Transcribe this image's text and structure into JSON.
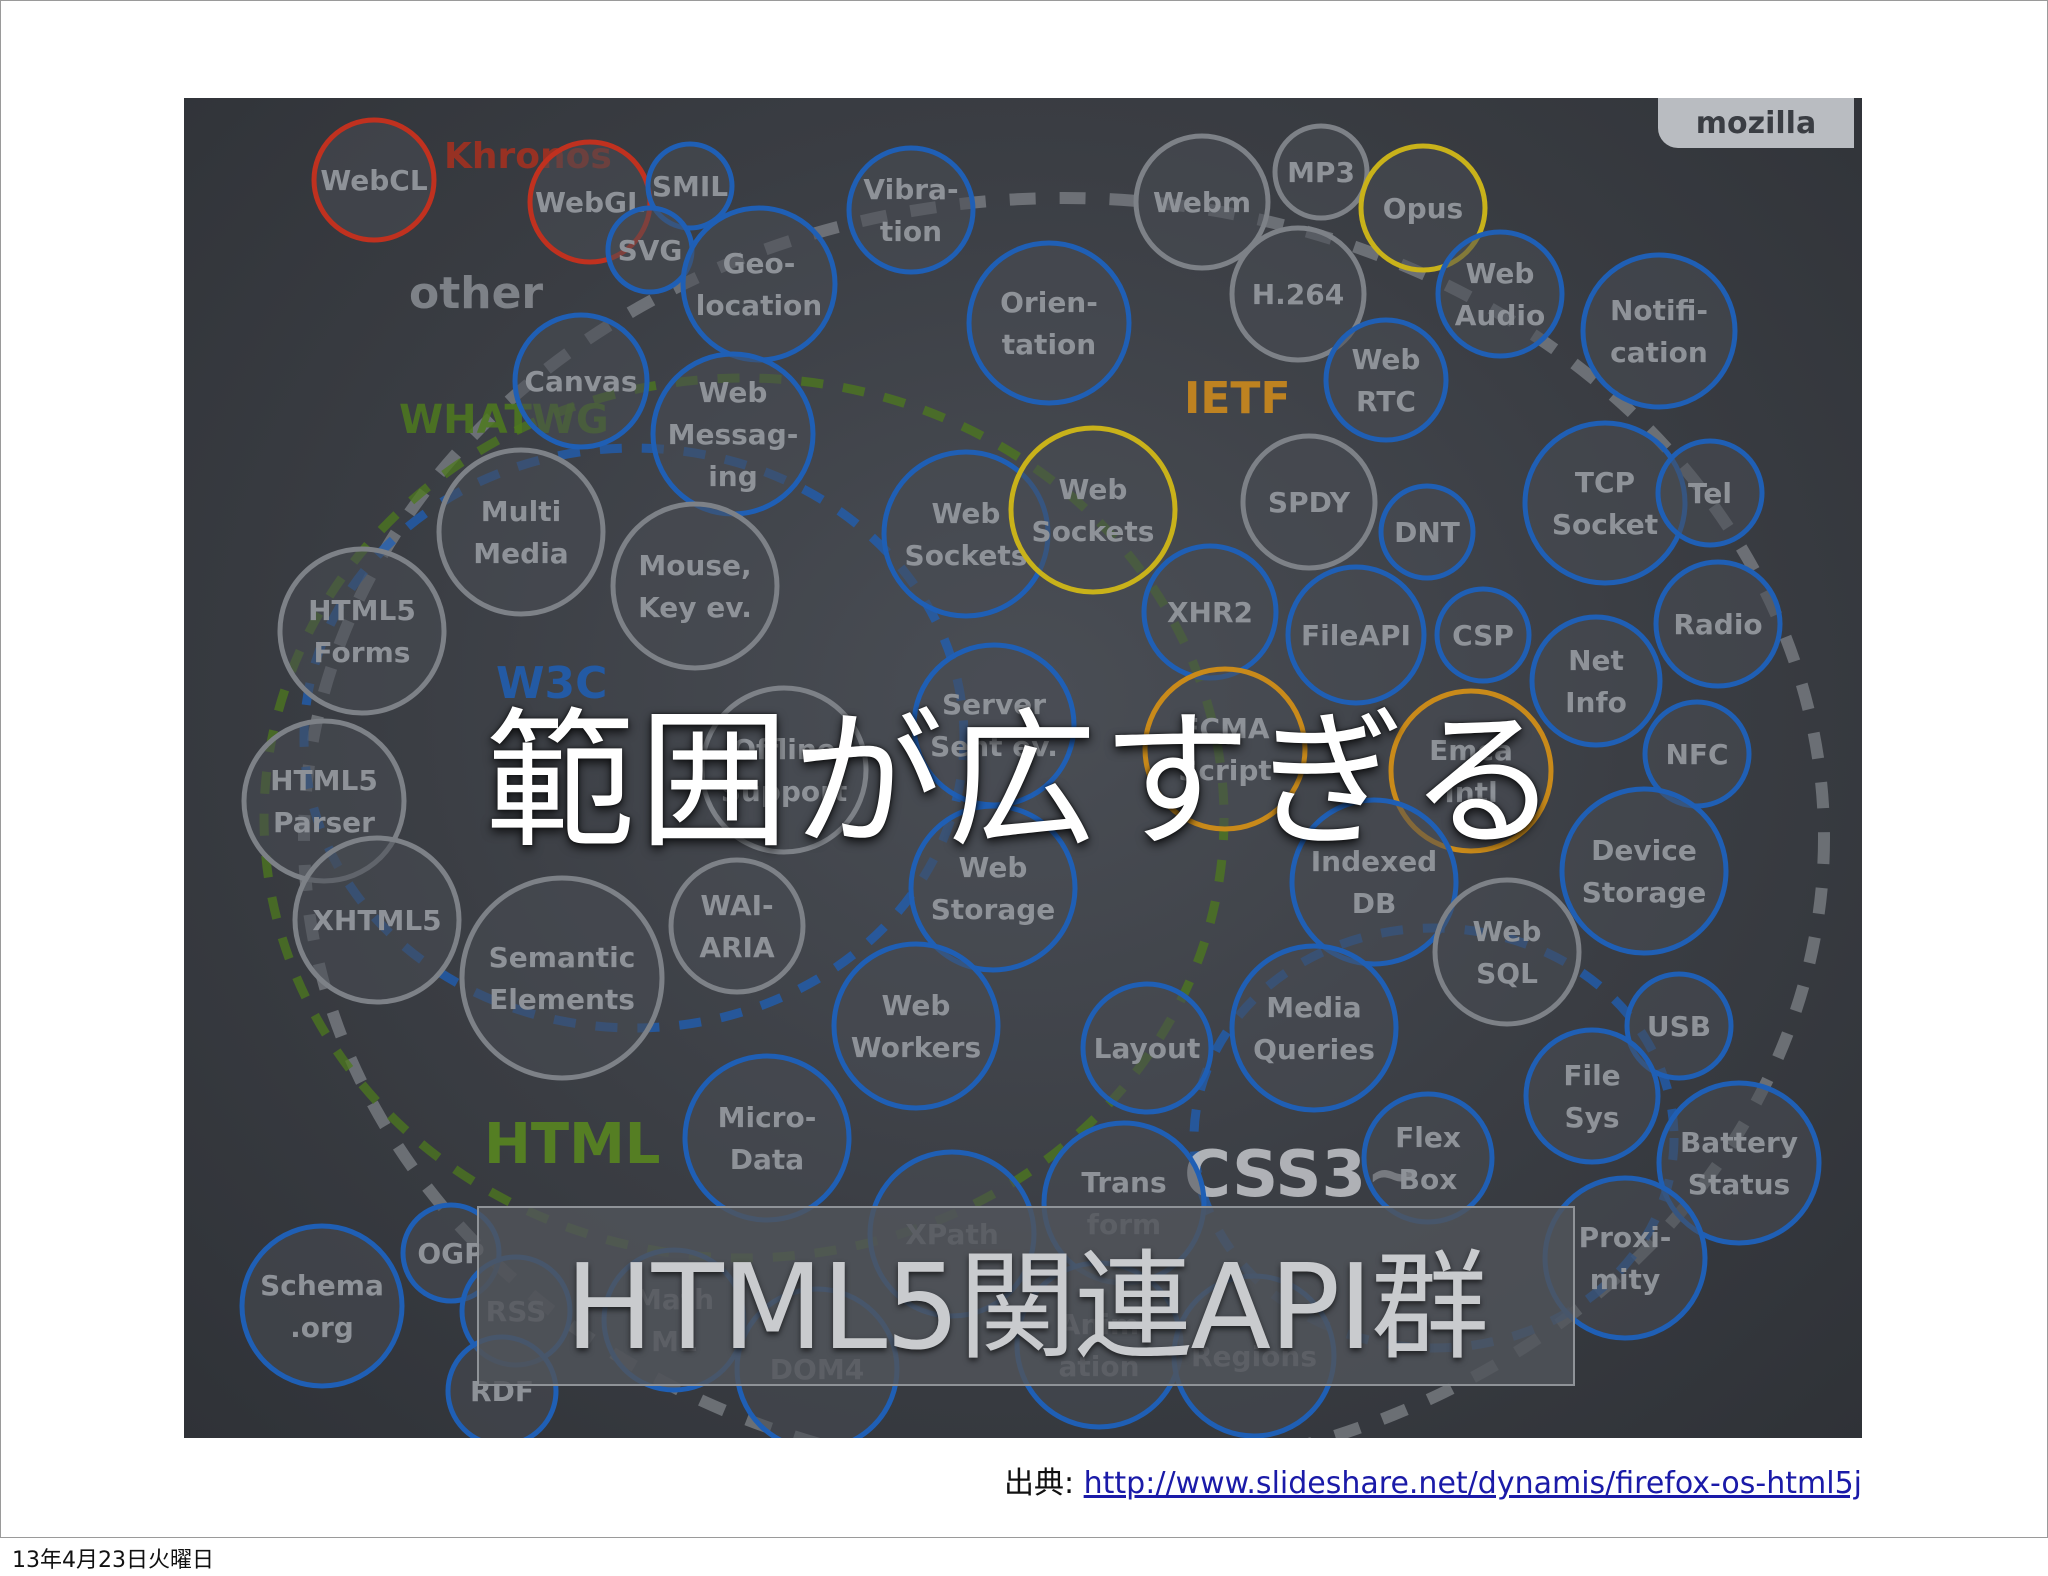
{
  "slide": {
    "headline": "範囲が広すぎる",
    "caption": "HTML5関連API群",
    "source_prefix": "出典: ",
    "source_url": "http://www.slideshare.net/dynamis/firefox-os-html5j",
    "date_stamp": "13年4月23日火曜日"
  },
  "diagram": {
    "brand": "mozilla",
    "colors": {
      "blue": "#1f5fb5",
      "gray": "#7d8187",
      "red": "#c0311f",
      "yellow": "#c9b21a",
      "orange": "#c98a1a",
      "green": "#4e7a1e"
    },
    "groups": [
      {
        "name": "khronos",
        "label": "Khronos",
        "color": "red"
      },
      {
        "name": "other",
        "label": "other",
        "color": "gray"
      },
      {
        "name": "whatwg",
        "label": "WHATWG",
        "color": "green"
      },
      {
        "name": "w3c",
        "label": "W3C",
        "color": "blue"
      },
      {
        "name": "ietf",
        "label": "IETF",
        "color": "orange"
      },
      {
        "name": "html",
        "label": "HTML",
        "color": "green"
      },
      {
        "name": "css3",
        "label": "CSS3~",
        "color": "gray"
      }
    ],
    "bubbles": [
      {
        "lines": [
          "WebCL"
        ],
        "color": "red"
      },
      {
        "lines": [
          "WebGL"
        ],
        "color": "red"
      },
      {
        "lines": [
          "SMIL"
        ],
        "color": "blue"
      },
      {
        "lines": [
          "SVG"
        ],
        "color": "blue"
      },
      {
        "lines": [
          "Geo-",
          "location"
        ],
        "color": "blue"
      },
      {
        "lines": [
          "Vibra-",
          "tion"
        ],
        "color": "blue"
      },
      {
        "lines": [
          "Webm"
        ],
        "color": "gray"
      },
      {
        "lines": [
          "MP3"
        ],
        "color": "gray"
      },
      {
        "lines": [
          "Opus"
        ],
        "color": "yellow"
      },
      {
        "lines": [
          "H.264"
        ],
        "color": "gray"
      },
      {
        "lines": [
          "Orien-",
          "tation"
        ],
        "color": "blue"
      },
      {
        "lines": [
          "Canvas"
        ],
        "color": "blue"
      },
      {
        "lines": [
          "Web",
          "Messag-",
          "ing"
        ],
        "color": "blue"
      },
      {
        "lines": [
          "Web",
          "Audio"
        ],
        "color": "blue"
      },
      {
        "lines": [
          "Notifi-",
          "cation"
        ],
        "color": "blue"
      },
      {
        "lines": [
          "Web",
          "RTC"
        ],
        "color": "blue"
      },
      {
        "lines": [
          "Multi",
          "Media"
        ],
        "color": "gray"
      },
      {
        "lines": [
          "Mouse,",
          "Key ev."
        ],
        "color": "gray"
      },
      {
        "lines": [
          "Web",
          "Sockets"
        ],
        "color": "blue"
      },
      {
        "lines": [
          "Web",
          "Sockets"
        ],
        "color": "yellow"
      },
      {
        "lines": [
          "SPDY"
        ],
        "color": "gray"
      },
      {
        "lines": [
          "DNT"
        ],
        "color": "blue"
      },
      {
        "lines": [
          "TCP",
          "Socket"
        ],
        "color": "blue"
      },
      {
        "lines": [
          "Tel"
        ],
        "color": "blue"
      },
      {
        "lines": [
          "HTML5",
          "Forms"
        ],
        "color": "gray"
      },
      {
        "lines": [
          "XHR2"
        ],
        "color": "blue"
      },
      {
        "lines": [
          "FileAPI"
        ],
        "color": "blue"
      },
      {
        "lines": [
          "CSP"
        ],
        "color": "blue"
      },
      {
        "lines": [
          "Net",
          "Info"
        ],
        "color": "blue"
      },
      {
        "lines": [
          "Radio"
        ],
        "color": "blue"
      },
      {
        "lines": [
          "Offline",
          "Support"
        ],
        "color": "gray"
      },
      {
        "lines": [
          "Server",
          "Sent ev."
        ],
        "color": "blue"
      },
      {
        "lines": [
          "ECMA",
          "Script"
        ],
        "color": "orange"
      },
      {
        "lines": [
          "Emca",
          "Intl"
        ],
        "color": "orange"
      },
      {
        "lines": [
          "NFC"
        ],
        "color": "blue"
      },
      {
        "lines": [
          "HTML5",
          "Parser"
        ],
        "color": "gray"
      },
      {
        "lines": [
          "Web",
          "Storage"
        ],
        "color": "blue"
      },
      {
        "lines": [
          "Indexed",
          "DB"
        ],
        "color": "blue"
      },
      {
        "lines": [
          "Device",
          "Storage"
        ],
        "color": "blue"
      },
      {
        "lines": [
          "XHTML5"
        ],
        "color": "gray"
      },
      {
        "lines": [
          "WAI-",
          "ARIA"
        ],
        "color": "gray"
      },
      {
        "lines": [
          "Web",
          "SQL"
        ],
        "color": "gray"
      },
      {
        "lines": [
          "Semantic",
          "Elements"
        ],
        "color": "gray"
      },
      {
        "lines": [
          "Web",
          "Workers"
        ],
        "color": "blue"
      },
      {
        "lines": [
          "Layout"
        ],
        "color": "blue"
      },
      {
        "lines": [
          "Media",
          "Queries"
        ],
        "color": "blue"
      },
      {
        "lines": [
          "USB"
        ],
        "color": "blue"
      },
      {
        "lines": [
          "Micro-",
          "Data"
        ],
        "color": "blue"
      },
      {
        "lines": [
          "File",
          "Sys"
        ],
        "color": "blue"
      },
      {
        "lines": [
          "Battery",
          "Status"
        ],
        "color": "blue"
      },
      {
        "lines": [
          "Flex",
          "Box"
        ],
        "color": "blue"
      },
      {
        "lines": [
          "Trans",
          "form"
        ],
        "color": "blue"
      },
      {
        "lines": [
          "OGP"
        ],
        "color": "blue"
      },
      {
        "lines": [
          "XPath"
        ],
        "color": "blue"
      },
      {
        "lines": [
          "Proxi-",
          "mity"
        ],
        "color": "blue"
      },
      {
        "lines": [
          "Schema",
          ".org"
        ],
        "color": "blue"
      },
      {
        "lines": [
          "RSS"
        ],
        "color": "blue"
      },
      {
        "lines": [
          "Math",
          "ML"
        ],
        "color": "blue"
      },
      {
        "lines": [
          "RDF"
        ],
        "color": "blue"
      },
      {
        "lines": [
          "DOM4"
        ],
        "color": "blue"
      },
      {
        "lines": [
          "Anim",
          "ation"
        ],
        "color": "blue"
      },
      {
        "lines": [
          "Regions"
        ],
        "color": "blue"
      }
    ]
  }
}
